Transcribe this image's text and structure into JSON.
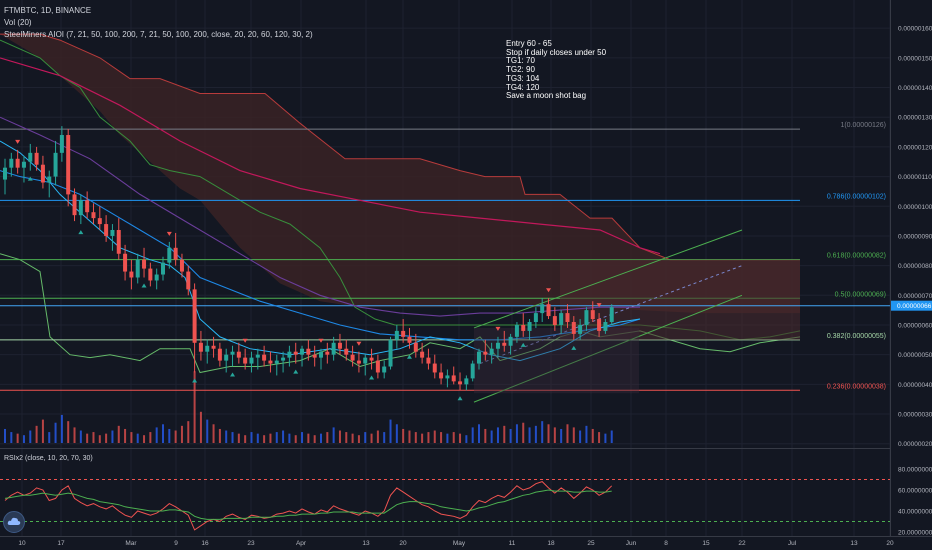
{
  "header": {
    "symbol_line": "FTMBTC, 1D, BINANCE",
    "vol_line": "Vol (20)",
    "indicator_line": "SteelMiners AIOI (7, 21, 50, 100, 200, 7, 21, 50, 100, 200, close, 20, 20, 60, 120, 30, 2)"
  },
  "note": {
    "lines": [
      "Entry 60 - 65",
      "Stop if daily closes under 50",
      "TG1: 70",
      "TG2: 90",
      "TG3: 104",
      "TG4: 120",
      "Save a moon shot bag"
    ]
  },
  "logo_icon": "tradingview-cloud-icon",
  "colors": {
    "background": "#131722",
    "up": "#26a69a",
    "down": "#ef5350",
    "volume_up": "#2962ff",
    "volume_down": "#ef5350",
    "ichimoku_cloud": "#3a2224",
    "fib_1": "#787b86",
    "fib_0786": "#2196f3",
    "fib_0618": "#4caf50",
    "fib_05": "#4caf50",
    "fib_0382": "#a5d6a7",
    "fib_0236": "#ef5350",
    "channel": "#4caf50",
    "rsi_fast": "#ef5350",
    "rsi_slow": "#4caf50"
  },
  "chart_data": [
    {
      "type": "candlestick",
      "title": "FTMBTC, 1D, BINANCE",
      "ylim": [
        2e-07,
        1.7e-06
      ],
      "y_tick_labels": [
        "0.00000160",
        "0.00000150",
        "0.00000140",
        "0.00000130",
        "0.00000120",
        "0.00000110",
        "0.00000100",
        "0.00000090",
        "0.00000080",
        "0.00000070",
        "0.00000060",
        "0.00000050",
        "0.00000040",
        "0.00000030",
        "0.00000020"
      ],
      "x_tick_labels": [
        "10",
        "17",
        "Mar",
        "9",
        "16",
        "23",
        "Apr",
        "13",
        "20",
        "May",
        "11",
        "18",
        "25",
        "Jun",
        "8",
        "15",
        "22",
        "Jul",
        "13",
        "20"
      ],
      "last_price_label": "0.00000066",
      "fib_levels": [
        {
          "label": "1(0.00000126)",
          "value": 126
        },
        {
          "label": "0.786(0.00000102)",
          "value": 102
        },
        {
          "label": "0.618(0.00000082)",
          "value": 82
        },
        {
          "label": "0.5(0.00000069)",
          "value": 69
        },
        {
          "label": "0.382(0.00000055)",
          "value": 55
        },
        {
          "label": "0.236(0.00000038)",
          "value": 38
        }
      ],
      "target_lines": [
        70,
        104
      ],
      "candles_ohlc_1e-8": [
        [
          109,
          116,
          104,
          113
        ],
        [
          113,
          118,
          110,
          116
        ],
        [
          116,
          119,
          111,
          113
        ],
        [
          113,
          117,
          108,
          115
        ],
        [
          115,
          121,
          112,
          118
        ],
        [
          118,
          120,
          112,
          114
        ],
        [
          114,
          117,
          106,
          108
        ],
        [
          108,
          112,
          103,
          110
        ],
        [
          110,
          122,
          107,
          118
        ],
        [
          118,
          127,
          115,
          124
        ],
        [
          124,
          126,
          100,
          104
        ],
        [
          104,
          106,
          95,
          97
        ],
        [
          97,
          104,
          94,
          102
        ],
        [
          102,
          105,
          96,
          98
        ],
        [
          98,
          101,
          94,
          96
        ],
        [
          96,
          100,
          92,
          94
        ],
        [
          94,
          97,
          88,
          90
        ],
        [
          90,
          94,
          85,
          92
        ],
        [
          92,
          96,
          82,
          84
        ],
        [
          84,
          87,
          75,
          78
        ],
        [
          78,
          82,
          72,
          76
        ],
        [
          76,
          84,
          74,
          82
        ],
        [
          82,
          86,
          76,
          79
        ],
        [
          79,
          81,
          73,
          75
        ],
        [
          75,
          79,
          72,
          77
        ],
        [
          77,
          83,
          75,
          81
        ],
        [
          81,
          88,
          79,
          86
        ],
        [
          86,
          91,
          80,
          82
        ],
        [
          82,
          84,
          76,
          78
        ],
        [
          78,
          80,
          70,
          72
        ],
        [
          72,
          74,
          44,
          54
        ],
        [
          54,
          58,
          48,
          51
        ],
        [
          51,
          55,
          47,
          53
        ],
        [
          53,
          56,
          49,
          52
        ],
        [
          52,
          54,
          46,
          48
        ],
        [
          48,
          52,
          44,
          50
        ],
        [
          50,
          53,
          46,
          51
        ],
        [
          51,
          54,
          47,
          49
        ],
        [
          49,
          52,
          45,
          47
        ],
        [
          47,
          51,
          44,
          49
        ],
        [
          49,
          52,
          45,
          50
        ],
        [
          50,
          53,
          46,
          48
        ],
        [
          48,
          51,
          44,
          47
        ],
        [
          47,
          50,
          43,
          48
        ],
        [
          48,
          51,
          44,
          49
        ],
        [
          49,
          53,
          46,
          51
        ],
        [
          51,
          54,
          47,
          50
        ],
        [
          50,
          53,
          46,
          52
        ],
        [
          52,
          55,
          48,
          50
        ],
        [
          50,
          53,
          46,
          49
        ],
        [
          49,
          52,
          45,
          51
        ],
        [
          51,
          54,
          47,
          50
        ],
        [
          50,
          56,
          48,
          54
        ],
        [
          54,
          57,
          50,
          52
        ],
        [
          52,
          55,
          48,
          50
        ],
        [
          50,
          53,
          46,
          48
        ],
        [
          48,
          51,
          44,
          47
        ],
        [
          47,
          50,
          43,
          49
        ],
        [
          49,
          52,
          45,
          48
        ],
        [
          48,
          50,
          42,
          44
        ],
        [
          44,
          48,
          42,
          46
        ],
        [
          46,
          56,
          45,
          55
        ],
        [
          55,
          60,
          52,
          58
        ],
        [
          58,
          62,
          54,
          56
        ],
        [
          56,
          59,
          52,
          54
        ],
        [
          54,
          57,
          49,
          51
        ],
        [
          51,
          54,
          47,
          49
        ],
        [
          49,
          52,
          45,
          47
        ],
        [
          47,
          50,
          42,
          44
        ],
        [
          44,
          47,
          40,
          42
        ],
        [
          42,
          45,
          39,
          43
        ],
        [
          43,
          46,
          40,
          41
        ],
        [
          41,
          44,
          38,
          40
        ],
        [
          40,
          43,
          38,
          42
        ],
        [
          42,
          48,
          41,
          47
        ],
        [
          47,
          52,
          45,
          51
        ],
        [
          51,
          55,
          48,
          50
        ],
        [
          50,
          54,
          47,
          52
        ],
        [
          52,
          56,
          49,
          54
        ],
        [
          54,
          58,
          51,
          53
        ],
        [
          53,
          57,
          50,
          56
        ],
        [
          56,
          61,
          54,
          60
        ],
        [
          60,
          64,
          56,
          58
        ],
        [
          58,
          62,
          55,
          61
        ],
        [
          61,
          66,
          59,
          64
        ],
        [
          64,
          69,
          61,
          67
        ],
        [
          67,
          69,
          62,
          63
        ],
        [
          63,
          66,
          58,
          60
        ],
        [
          60,
          65,
          57,
          64
        ],
        [
          64,
          67,
          59,
          61
        ],
        [
          61,
          63,
          55,
          57
        ],
        [
          57,
          62,
          55,
          60
        ],
        [
          60,
          66,
          58,
          65
        ],
        [
          65,
          68,
          61,
          62
        ],
        [
          62,
          64,
          56,
          58
        ],
        [
          58,
          62,
          57,
          61
        ],
        [
          61,
          67,
          60,
          66
        ]
      ],
      "volume": [
        18,
        14,
        12,
        10,
        16,
        22,
        30,
        14,
        26,
        36,
        28,
        20,
        16,
        12,
        14,
        10,
        12,
        16,
        22,
        18,
        14,
        12,
        10,
        14,
        20,
        24,
        18,
        16,
        22,
        28,
        92,
        40,
        30,
        24,
        18,
        16,
        14,
        12,
        10,
        14,
        12,
        10,
        12,
        14,
        16,
        12,
        10,
        14,
        12,
        10,
        12,
        14,
        20,
        16,
        14,
        12,
        10,
        14,
        12,
        16,
        14,
        30,
        24,
        18,
        16,
        14,
        12,
        14,
        16,
        14,
        12,
        14,
        12,
        10,
        20,
        24,
        18,
        16,
        20,
        22,
        18,
        24,
        26,
        20,
        22,
        28,
        24,
        20,
        18,
        24,
        20,
        16,
        22,
        18,
        14,
        12,
        16
      ]
    },
    {
      "type": "line",
      "title": "RSIx2 (close, 10, 20, 70, 30)",
      "ylim": [
        20,
        80
      ],
      "y_tick_labels": [
        "80.0000000",
        "60.0000000",
        "40.0000000",
        "20.0000000"
      ],
      "levels": [
        70,
        30
      ],
      "series": [
        {
          "values": [
            50,
            55,
            58,
            55,
            57,
            62,
            60,
            50,
            52,
            60,
            64,
            52,
            48,
            45,
            47,
            44,
            42,
            45,
            40,
            36,
            34,
            40,
            38,
            36,
            38,
            42,
            47,
            44,
            40,
            36,
            22,
            26,
            30,
            32,
            30,
            35,
            37,
            34,
            32,
            36,
            35,
            33,
            34,
            37,
            38,
            40,
            38,
            42,
            39,
            37,
            41,
            39,
            45,
            42,
            40,
            38,
            36,
            40,
            38,
            35,
            40,
            55,
            62,
            58,
            54,
            50,
            46,
            44,
            40,
            37,
            36,
            35,
            33,
            36,
            44,
            50,
            48,
            52,
            55,
            53,
            58,
            64,
            60,
            62,
            66,
            68,
            62,
            57,
            62,
            58,
            52,
            57,
            63,
            60,
            55,
            58,
            64
          ]
        },
        {
          "values": [
            52,
            53,
            54,
            55,
            55,
            56,
            57,
            56,
            55,
            56,
            57,
            56,
            54,
            52,
            51,
            49,
            48,
            47,
            46,
            44,
            43,
            42,
            41,
            40,
            40,
            40,
            41,
            41,
            40,
            39,
            35,
            33,
            32,
            32,
            32,
            33,
            33,
            33,
            33,
            34,
            34,
            34,
            34,
            35,
            35,
            36,
            36,
            37,
            37,
            37,
            38,
            38,
            39,
            39,
            39,
            39,
            38,
            38,
            38,
            38,
            38,
            42,
            46,
            48,
            49,
            49,
            48,
            47,
            46,
            44,
            43,
            42,
            41,
            40,
            41,
            43,
            44,
            46,
            48,
            49,
            51,
            53,
            55,
            56,
            58,
            59,
            60,
            59,
            59,
            59,
            58,
            58,
            59,
            59,
            58,
            58,
            59
          ]
        }
      ]
    }
  ]
}
